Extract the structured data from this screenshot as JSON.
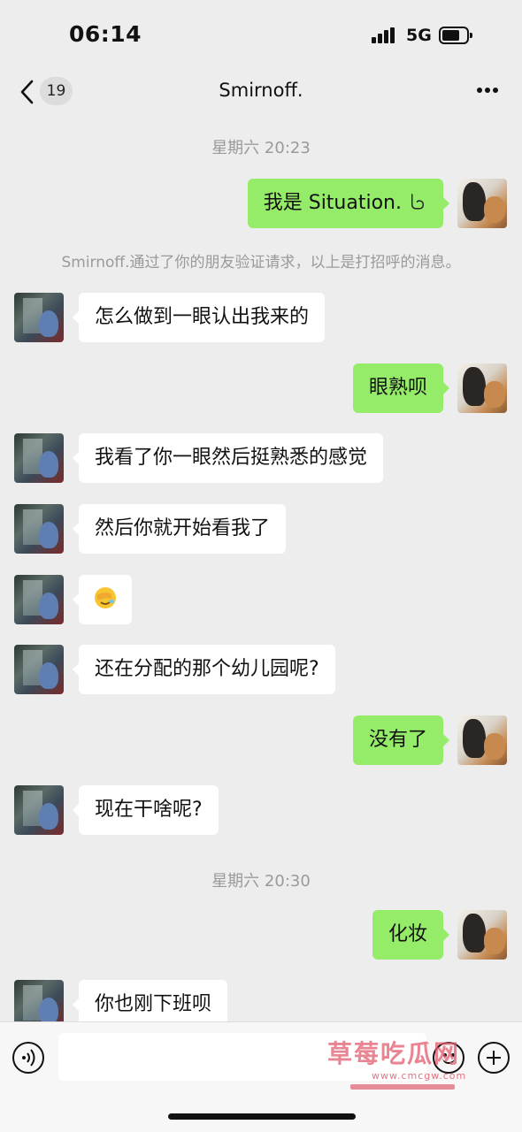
{
  "status_bar": {
    "time": "06:14",
    "network": "5G"
  },
  "header": {
    "back_badge": "19",
    "title": "Smirnoff."
  },
  "timestamps": [
    "星期六 20:23",
    "星期六 20:30"
  ],
  "system_message": "Smirnoff.通过了你的朋友验证请求，以上是打招呼的消息。",
  "messages": [
    {
      "from": "me",
      "text": "我是 Situation."
    },
    {
      "from": "them",
      "text": "怎么做到一眼认出我来的"
    },
    {
      "from": "me",
      "text": "眼熟呗"
    },
    {
      "from": "them",
      "text": "我看了你一眼然后挺熟悉的感觉"
    },
    {
      "from": "them",
      "text": "然后你就开始看我了"
    },
    {
      "from": "them",
      "emoji": "facepalm-emoji"
    },
    {
      "from": "them",
      "text": "还在分配的那个幼儿园呢?"
    },
    {
      "from": "me",
      "text": "没有了"
    },
    {
      "from": "them",
      "text": "现在干啥呢?"
    },
    {
      "from": "me",
      "text": "化妆"
    },
    {
      "from": "them",
      "text": "你也刚下班呗"
    }
  ],
  "watermark": {
    "text": "草莓吃瓜网",
    "subtext": "www.cmcgw.com"
  },
  "colors": {
    "background": "#ededed",
    "outgoing_bubble": "#95ec69",
    "incoming_bubble": "#ffffff",
    "meta_text": "#9a9a9a"
  }
}
